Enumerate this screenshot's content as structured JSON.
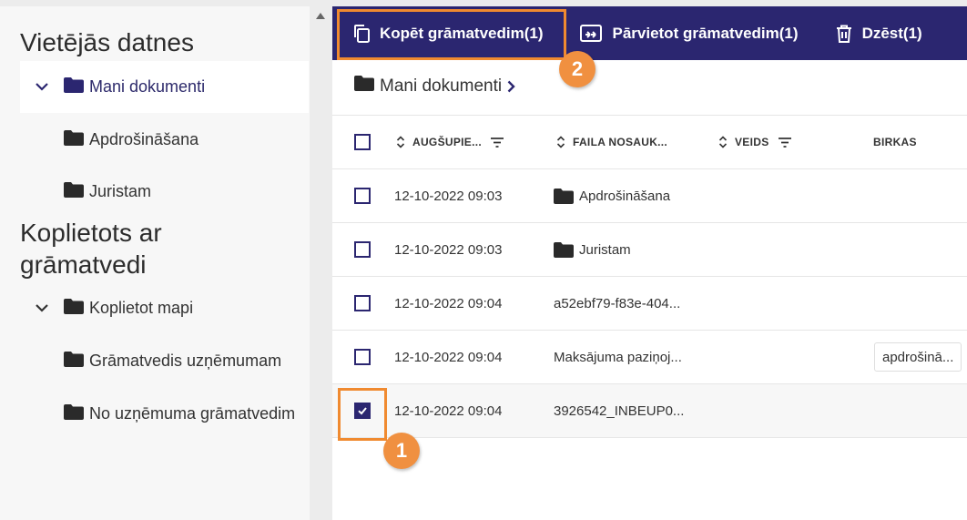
{
  "sidebar": {
    "local_title": "Vietējās datnes",
    "local_items": [
      {
        "label": "Mani dokumenti"
      },
      {
        "label": "Apdrošināšana"
      },
      {
        "label": "Juristam"
      }
    ],
    "shared_title_line1": "Koplietots ar",
    "shared_title_line2": "grāmatvedi",
    "shared_items": [
      {
        "label": "Koplietot mapi"
      },
      {
        "label": "Grāmatvedis uzņēmumam"
      },
      {
        "label": "No uzņēmuma grāmatvedim"
      }
    ]
  },
  "toolbar": {
    "copy_label": "Kopēt grāmatvedim(1)",
    "move_label": "Pārvietot grāmatvedim(1)",
    "delete_label": "Dzēst(1)"
  },
  "breadcrumb": {
    "label": "Mani dokumenti"
  },
  "table": {
    "headers": [
      "AUGŠUPIE...",
      "FAILA NOSAUK...",
      "VEIDS",
      "BIRKAS"
    ],
    "rows": [
      {
        "date": "12-10-2022 09:03",
        "name": "Apdrošināšana",
        "is_folder": true,
        "tag": "",
        "checked": false
      },
      {
        "date": "12-10-2022 09:03",
        "name": "Juristam",
        "is_folder": true,
        "tag": "",
        "checked": false
      },
      {
        "date": "12-10-2022 09:04",
        "name": "a52ebf79-f83e-404...",
        "is_folder": false,
        "tag": "",
        "checked": false
      },
      {
        "date": "12-10-2022 09:04",
        "name": "Maksājuma paziņoj...",
        "is_folder": false,
        "tag": "apdrošinā...",
        "checked": false
      },
      {
        "date": "12-10-2022 09:04",
        "name": "3926542_INBEUP0...",
        "is_folder": false,
        "tag": "",
        "checked": true
      }
    ]
  },
  "annotations": {
    "badge_1": "1",
    "badge_2": "2"
  },
  "colors": {
    "primary": "#2b2670",
    "highlight": "#f08a30",
    "badge": "#f09040"
  },
  "icons": [
    "chevron-down-icon",
    "folder-icon",
    "copy-icon",
    "move-icon",
    "trash-icon",
    "chevron-right-icon",
    "sort-icon",
    "filter-icon",
    "check-icon"
  ]
}
